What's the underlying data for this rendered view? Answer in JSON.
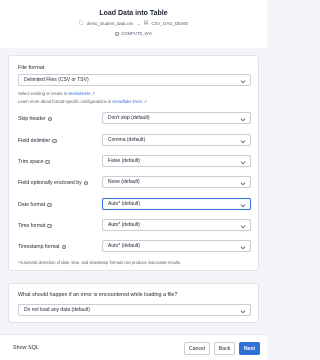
{
  "header": {
    "title": "Load Data into Table",
    "file_name": "demo_student_data.csv",
    "arrow": "→",
    "target": "CSV_OAG_DEMO",
    "warehouse": "COMPUTE_WH"
  },
  "file_format": {
    "label": "File format",
    "selected": "Delimited Files (CSV or TSV)",
    "help_prefix": "Select existing or create in ",
    "help_link": "Worksheets",
    "learn_prefix": "Learn more about format-specific configurations in ",
    "learn_link": "Snowflake Docs"
  },
  "options": [
    {
      "label": "Skip header",
      "value": "Don't skip (default)"
    },
    {
      "label": "Field delimiter",
      "value": "Comma (default)"
    },
    {
      "label": "Trim space",
      "value": "False (default)"
    },
    {
      "label": "Field optionally enclosed by",
      "value": "None (default)"
    },
    {
      "label": "Date format",
      "value": "Auto* (default)"
    },
    {
      "label": "Time format",
      "value": "Auto* (default)"
    },
    {
      "label": "Timestamp format",
      "value": "Auto* (default)"
    }
  ],
  "note": "*Automatic detection of date, time, and timestamp formats can produce inaccurate results.",
  "error_section": {
    "question": "What should happen if an error is encountered while loading a file?",
    "selected": "Do not load any data (default)"
  },
  "footer": {
    "show_sql": "Show SQL",
    "cancel": "Cancel",
    "back": "Back",
    "next": "Next"
  },
  "colors": {
    "accent": "#2f6fd6",
    "background": "#f4f5f8"
  }
}
